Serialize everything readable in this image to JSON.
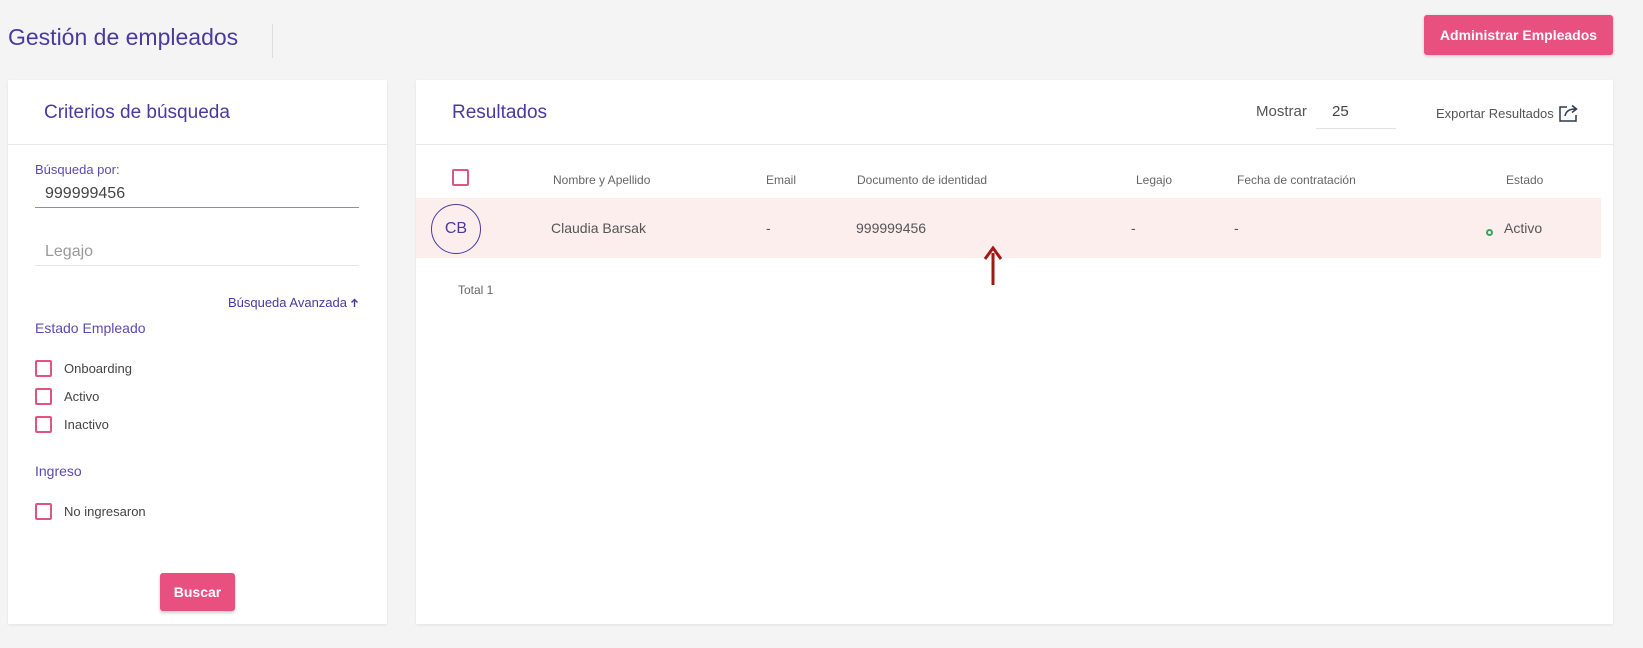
{
  "header": {
    "title": "Gestión de empleados",
    "admin_button": "Administrar Empleados"
  },
  "search": {
    "title": "Criterios de búsqueda",
    "search_by_label": "Búsqueda por:",
    "search_value": "999999456",
    "legajo_placeholder": "Legajo",
    "advanced_link": "Búsqueda Avanzada",
    "estado_label": "Estado Empleado",
    "estado_options": [
      "Onboarding",
      "Activo",
      "Inactivo"
    ],
    "ingreso_label": "Ingreso",
    "ingreso_options": [
      "No ingresaron"
    ],
    "search_button": "Buscar"
  },
  "results": {
    "title": "Resultados",
    "show_label": "Mostrar",
    "show_value": "25",
    "export_label": "Exportar Resultados",
    "columns": [
      "Nombre y Apellido",
      "Email",
      "Documento de identidad",
      "Legajo",
      "Fecha de contratación",
      "Estado"
    ],
    "rows": [
      {
        "initials": "CB",
        "name": "Claudia Barsak",
        "email": "-",
        "document": "999999456",
        "legajo": "-",
        "hire_date": "-",
        "status": "Activo"
      }
    ],
    "total": "Total 1"
  },
  "colors": {
    "accent": "#e8507f",
    "brand": "#4a3aa0",
    "row_highlight": "#fdeeee",
    "status_active": "#3aa55a",
    "arrow": "#a01818"
  }
}
